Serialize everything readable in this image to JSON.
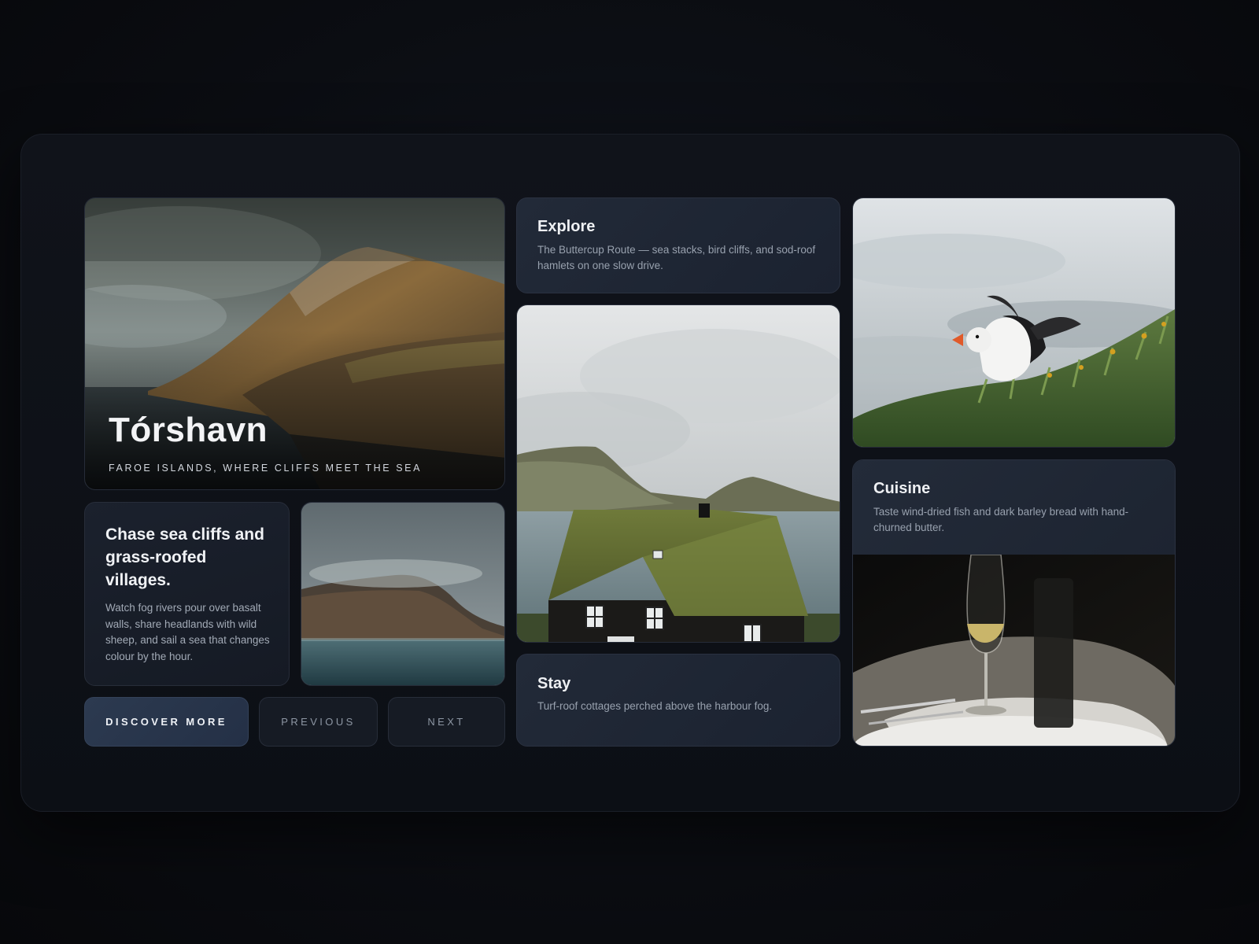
{
  "hero": {
    "title": "Tórshavn",
    "subtitle": "FAROE ISLANDS, WHERE CLIFFS MEET THE SEA"
  },
  "intro": {
    "title": "Chase sea cliffs and grass-roofed villages.",
    "text": "Watch fog rivers pour over basalt walls, share headlands with wild sheep, and sail a sea that changes colour by the hour."
  },
  "explore": {
    "title": "Explore",
    "text": "The Buttercup Route — sea stacks, bird cliffs, and sod-roof hamlets on one slow drive."
  },
  "stay": {
    "title": "Stay",
    "text": "Turf-roof cottages perched above the harbour fog."
  },
  "cuisine": {
    "title": "Cuisine",
    "text": "Taste wind-dried fish and dark barley bread with hand-churned butter."
  },
  "buttons": {
    "discover": "DISCOVER MORE",
    "previous": "PREVIOUS",
    "next": "NEXT"
  },
  "colors": {
    "background": "#0b0d12",
    "panel": "#1f2634",
    "accent_button": "#2a374c"
  }
}
